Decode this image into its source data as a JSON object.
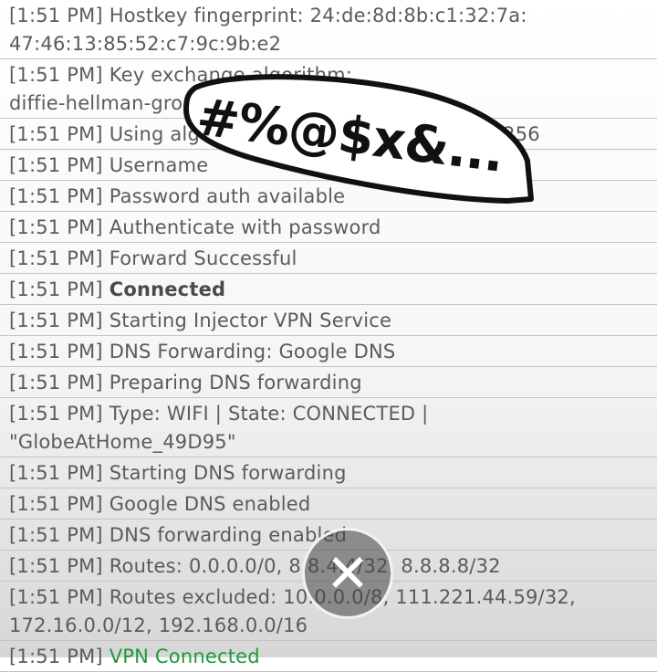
{
  "log": {
    "entries": [
      {
        "time": "[1:51 PM]",
        "message": "Hostkey fingerprint: 24:de:8d:8b:c1:32:7a:\n47:46:13:85:52:c7:9c:9b:e2"
      },
      {
        "time": "[1:51 PM]",
        "message": "Key exchange algorithm:\ndiffie-hellman-group-exchange-sha256"
      },
      {
        "time": "[1:51 PM]",
        "message": "Using algorithm: aes128-ctr hmac-sha2-256"
      },
      {
        "time": "[1:51 PM]",
        "message": "Username"
      },
      {
        "time": "[1:51 PM]",
        "message": "Password auth available"
      },
      {
        "time": "[1:51 PM]",
        "message": "Authenticate with password"
      },
      {
        "time": "[1:51 PM]",
        "message": "Forward Successful"
      },
      {
        "time": "[1:51 PM]",
        "message": "Connected",
        "style": "bold"
      },
      {
        "time": "[1:51 PM]",
        "message": "Starting Injector VPN Service"
      },
      {
        "time": "[1:51 PM]",
        "message": "DNS Forwarding: Google DNS"
      },
      {
        "time": "[1:51 PM]",
        "message": "Preparing DNS forwarding"
      },
      {
        "time": "[1:51 PM]",
        "message": "Type: WIFI | State: CONNECTED |\n\"GlobeAtHome_49D95\""
      },
      {
        "time": "[1:51 PM]",
        "message": "Starting DNS forwarding"
      },
      {
        "time": "[1:51 PM]",
        "message": "Google DNS enabled"
      },
      {
        "time": "[1:51 PM]",
        "message": "DNS forwarding enabled"
      },
      {
        "time": "[1:51 PM]",
        "message": "Routes: 0.0.0.0/0, 8.8.4.4/32, 8.8.8.8/32"
      },
      {
        "time": "[1:51 PM]",
        "message": "Routes excluded: 10.0.0.0/8, 111.221.44.59/32,\n172.16.0.0/12, 192.168.0.0/16"
      },
      {
        "time": "[1:51 PM]",
        "message": "VPN Connected",
        "style": "green"
      }
    ]
  },
  "sticker": {
    "text": "#%@$x&..."
  },
  "close_button": {
    "icon": "close-icon",
    "glyph": "✕"
  },
  "colors": {
    "text": "#5b5b5b",
    "success": "#1d9a3a",
    "divider": "#c4c4c4"
  }
}
